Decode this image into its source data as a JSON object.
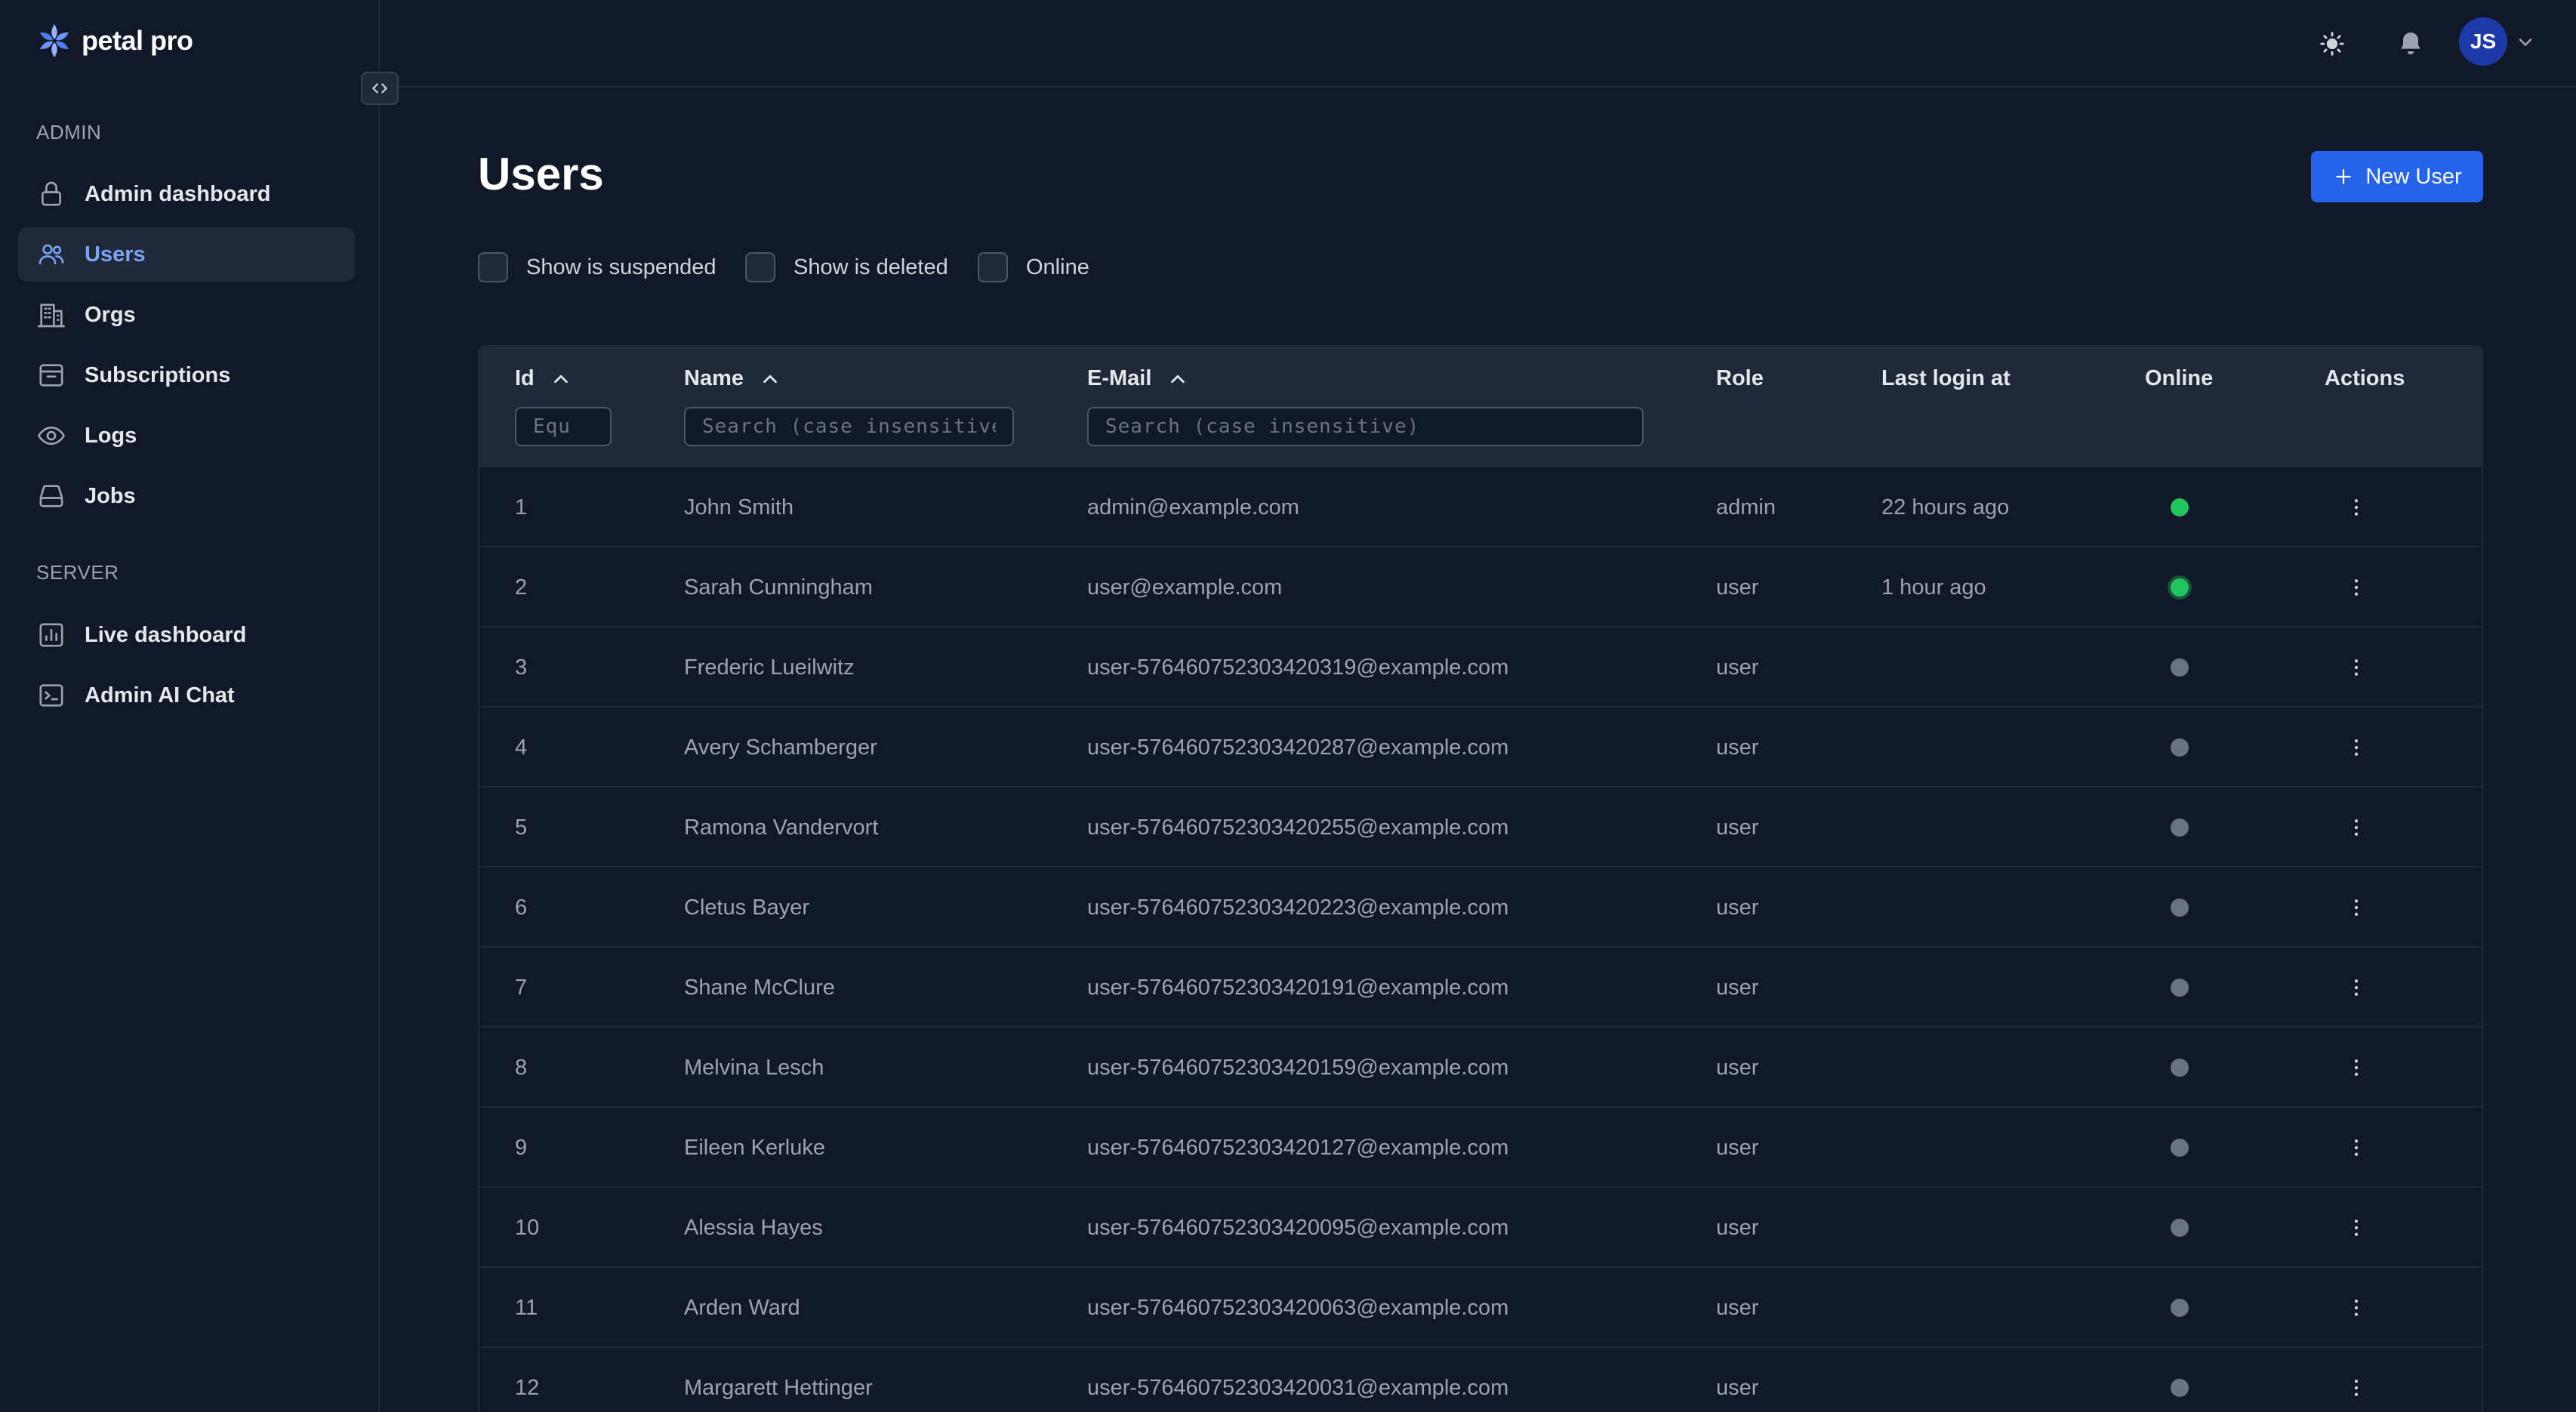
{
  "brand": {
    "name": "petal pro"
  },
  "sidebar": {
    "sections": [
      {
        "label": "ADMIN",
        "items": [
          {
            "label": "Admin dashboard",
            "icon": "lock-icon",
            "active": false
          },
          {
            "label": "Users",
            "icon": "users-icon",
            "active": true
          },
          {
            "label": "Orgs",
            "icon": "building-icon",
            "active": false
          },
          {
            "label": "Subscriptions",
            "icon": "archive-box-icon",
            "active": false
          },
          {
            "label": "Logs",
            "icon": "eye-icon",
            "active": false
          },
          {
            "label": "Jobs",
            "icon": "inbox-icon",
            "active": false
          }
        ]
      },
      {
        "label": "SERVER",
        "items": [
          {
            "label": "Live dashboard",
            "icon": "chart-bar-icon",
            "active": false
          },
          {
            "label": "Admin AI Chat",
            "icon": "terminal-icon",
            "active": false
          }
        ]
      }
    ]
  },
  "header": {
    "avatar_initials": "JS",
    "icons": [
      "sun-icon",
      "bell-icon",
      "chevron-down-icon"
    ]
  },
  "main": {
    "title": "Users",
    "new_user_label": "New User",
    "filters": [
      {
        "label": "Show is suspended",
        "checked": false
      },
      {
        "label": "Show is deleted",
        "checked": false
      },
      {
        "label": "Online",
        "checked": false
      }
    ]
  },
  "table": {
    "columns": {
      "id": "Id",
      "name": "Name",
      "email": "E-Mail",
      "role": "Role",
      "last_login": "Last login at",
      "online": "Online",
      "actions": "Actions"
    },
    "placeholders": {
      "id": "Equ",
      "name": "Search (case insensitive)",
      "email": "Search (case insensitive)"
    },
    "rows": [
      {
        "id": "1",
        "name": "John Smith",
        "email": "admin@example.com",
        "role": "admin",
        "last_login": "22 hours ago",
        "online": true
      },
      {
        "id": "2",
        "name": "Sarah Cunningham",
        "email": "user@example.com",
        "role": "user",
        "last_login": "1 hour ago",
        "online": true
      },
      {
        "id": "3",
        "name": "Frederic Lueilwitz",
        "email": "user-576460752303420319@example.com",
        "role": "user",
        "last_login": "",
        "online": false
      },
      {
        "id": "4",
        "name": "Avery Schamberger",
        "email": "user-576460752303420287@example.com",
        "role": "user",
        "last_login": "",
        "online": false
      },
      {
        "id": "5",
        "name": "Ramona Vandervort",
        "email": "user-576460752303420255@example.com",
        "role": "user",
        "last_login": "",
        "online": false
      },
      {
        "id": "6",
        "name": "Cletus Bayer",
        "email": "user-576460752303420223@example.com",
        "role": "user",
        "last_login": "",
        "online": false
      },
      {
        "id": "7",
        "name": "Shane McClure",
        "email": "user-576460752303420191@example.com",
        "role": "user",
        "last_login": "",
        "online": false
      },
      {
        "id": "8",
        "name": "Melvina Lesch",
        "email": "user-576460752303420159@example.com",
        "role": "user",
        "last_login": "",
        "online": false
      },
      {
        "id": "9",
        "name": "Eileen Kerluke",
        "email": "user-576460752303420127@example.com",
        "role": "user",
        "last_login": "",
        "online": false
      },
      {
        "id": "10",
        "name": "Alessia Hayes",
        "email": "user-576460752303420095@example.com",
        "role": "user",
        "last_login": "",
        "online": false
      },
      {
        "id": "11",
        "name": "Arden Ward",
        "email": "user-576460752303420063@example.com",
        "role": "user",
        "last_login": "",
        "online": false
      },
      {
        "id": "12",
        "name": "Margarett Hettinger",
        "email": "user-576460752303420031@example.com",
        "role": "user",
        "last_login": "",
        "online": false
      }
    ]
  },
  "colors": {
    "background": "#111827",
    "panel": "#1f2937",
    "accent": "#2563eb",
    "active_text": "#7aa3f8",
    "online": "#22c55e",
    "offline": "#6b7280"
  }
}
